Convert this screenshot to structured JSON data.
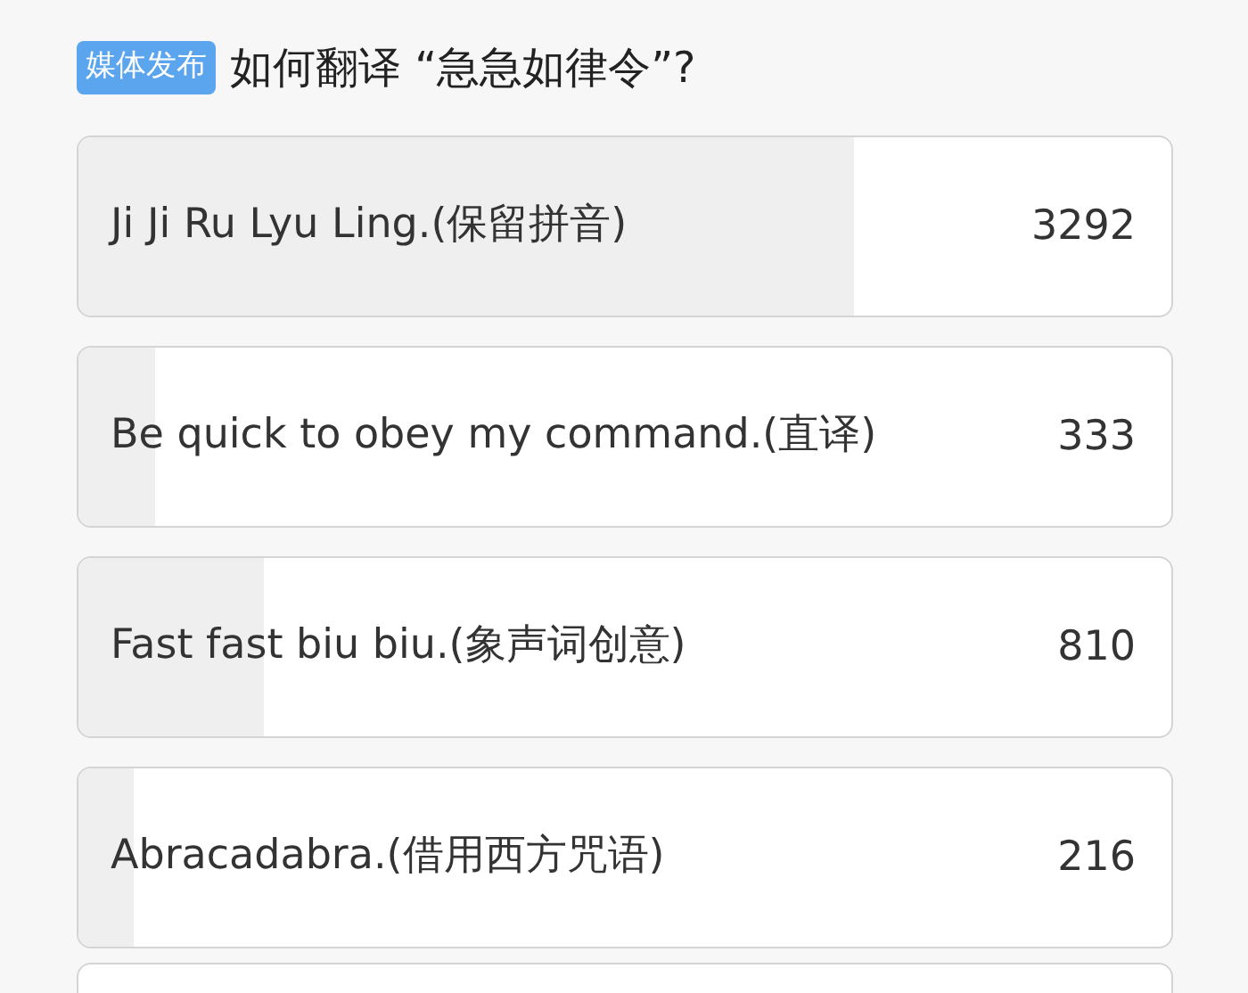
{
  "poll": {
    "tag": "媒体发布",
    "question": "如何翻译 “急急如律令”?",
    "options": [
      {
        "label": "Ji Ji Ru Lyu Ling.(保留拼音)",
        "count": "3292",
        "level": 0.71
      },
      {
        "label": "Be quick to obey my command.(直译)",
        "count": "333",
        "level": 0.07
      },
      {
        "label": "Fast fast biu biu.(象声词创意)",
        "count": "810",
        "level": 0.17
      },
      {
        "label": "Abracadabra.(借用西方咒语)",
        "count": "216",
        "level": 0.05
      }
    ]
  }
}
